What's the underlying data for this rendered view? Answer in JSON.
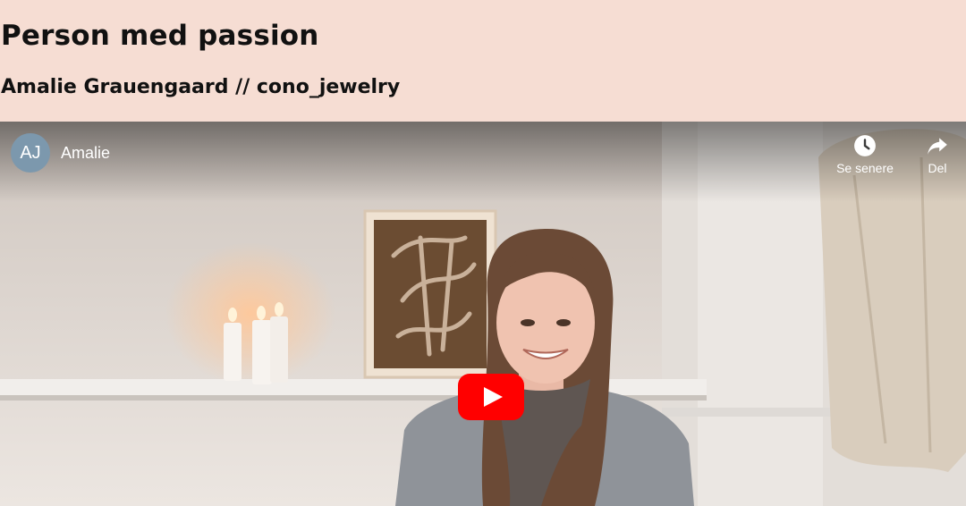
{
  "header": {
    "title": "Person med passion",
    "subtitle": "Amalie Grauengaard // cono_jewelry"
  },
  "player": {
    "channel_initials": "AJ",
    "channel_name": "Amalie",
    "watch_later_label": "Se senere",
    "share_label": "Del",
    "icons": {
      "watch_later": "clock-icon",
      "share": "share-arrow-icon",
      "play": "youtube-play-icon"
    },
    "colors": {
      "play_button": "#ff0000",
      "avatar": "#7c98ad",
      "header_bg": "#f6ddd3"
    }
  }
}
